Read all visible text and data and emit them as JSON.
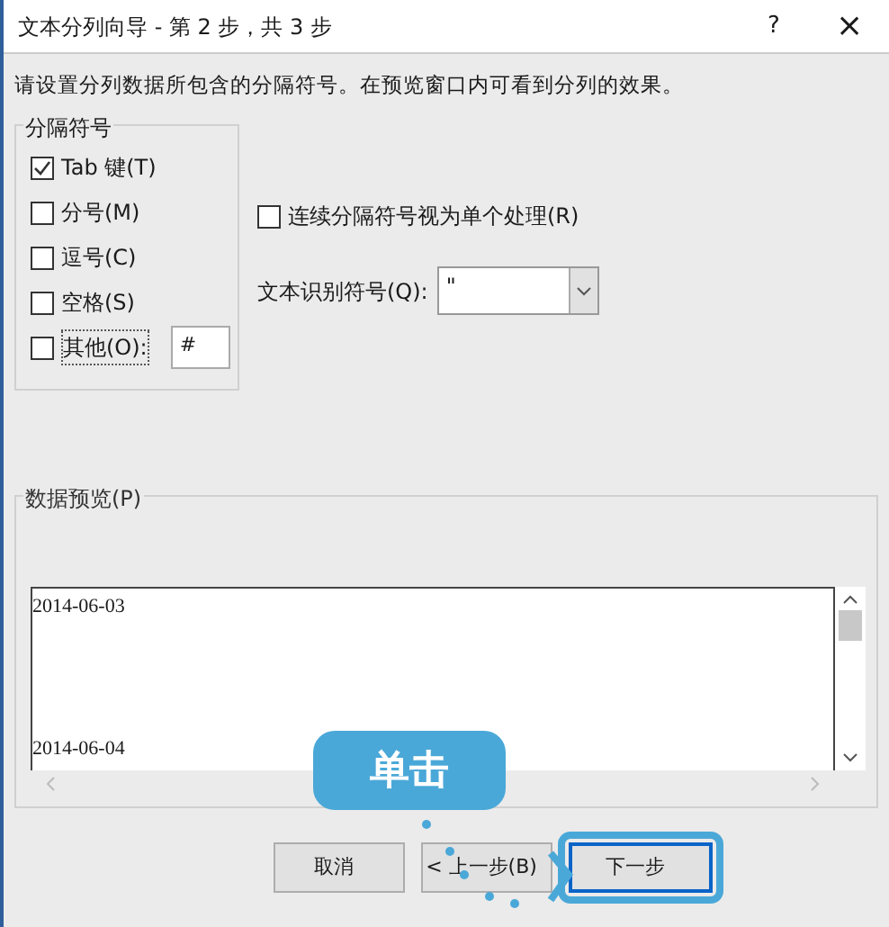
{
  "window": {
    "title": "文本分列向导 - 第 2 步，共 3 步",
    "help": "?",
    "close": "×"
  },
  "instruction": "请设置分列数据所包含的分隔符号。在预览窗口内可看到分列的效果。",
  "delimiters": {
    "title": "分隔符号",
    "items": [
      {
        "kind": "checkbox",
        "label": "Tab 键(T)",
        "checked": true
      },
      {
        "kind": "checkbox",
        "label": "分号(M)",
        "checked": false
      },
      {
        "kind": "checkbox",
        "label": "逗号(C)",
        "checked": false
      },
      {
        "kind": "checkbox",
        "label": "空格(S)",
        "checked": false
      },
      {
        "kind": "other",
        "label": "其他(O):",
        "checked": false,
        "value": "#"
      }
    ]
  },
  "consecutive": {
    "label": "连续分隔符号视为单个处理(R)",
    "checked": false
  },
  "text_qualifier": {
    "label": "文本识别符号(Q):",
    "value": "\""
  },
  "preview": {
    "title": "数据预览(P)",
    "rows": [
      "2014-06-03",
      "2014-06-04"
    ]
  },
  "buttons": [
    {
      "label": "取消",
      "highlighted": false
    },
    {
      "label": "< 上一步(B)",
      "highlighted": false
    },
    {
      "label": "下一步",
      "highlighted": true
    }
  ],
  "callout": {
    "text": "单击"
  }
}
